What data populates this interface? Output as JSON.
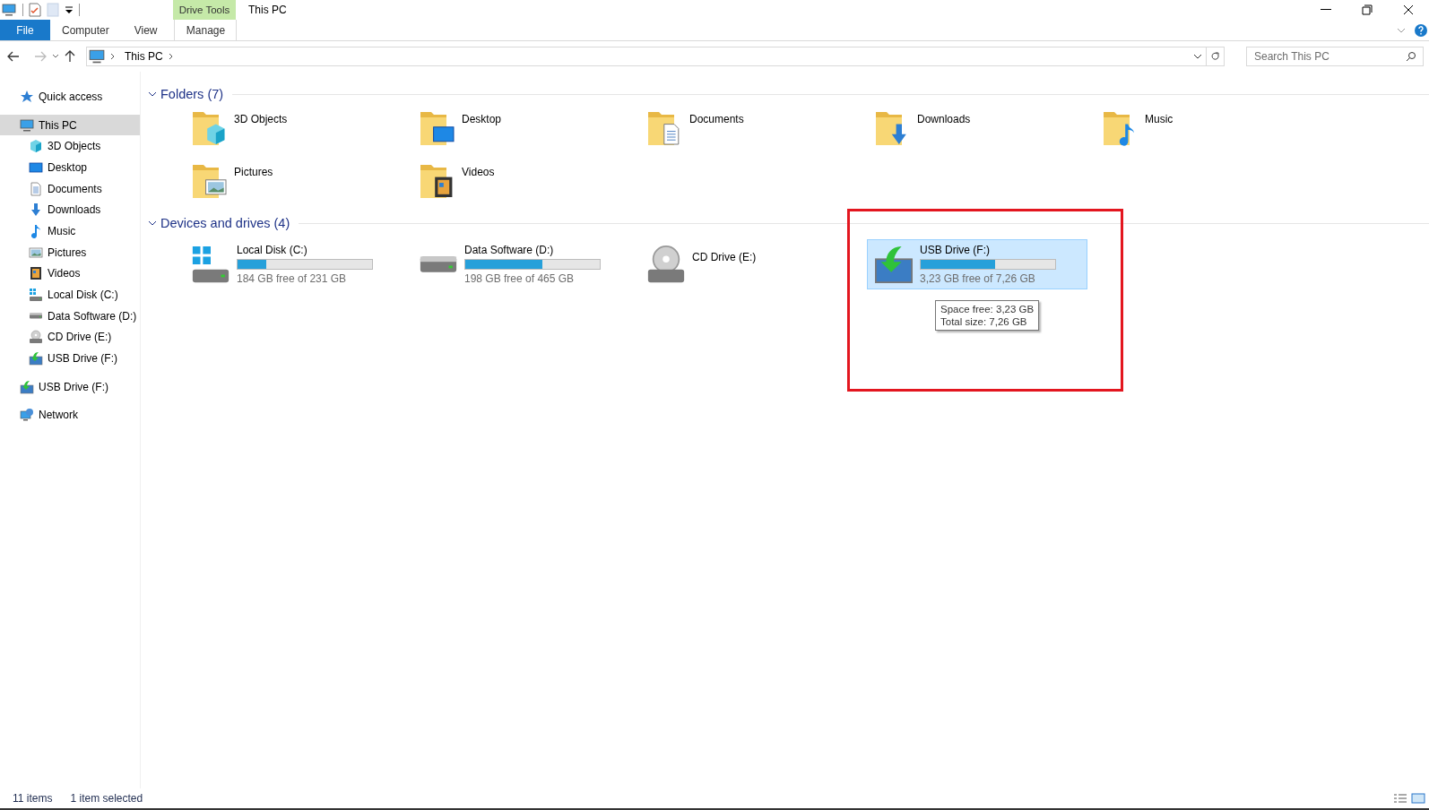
{
  "title_bar": {
    "context_tab": "Drive Tools",
    "title": "This PC"
  },
  "ribbon": {
    "tabs": [
      {
        "label": "File",
        "kind": "file"
      },
      {
        "label": "Computer",
        "kind": "normal"
      },
      {
        "label": "View",
        "kind": "normal"
      },
      {
        "label": "Manage",
        "kind": "context"
      }
    ]
  },
  "address": {
    "path": "This PC",
    "search_placeholder": "Search This PC"
  },
  "sidebar": {
    "items": [
      {
        "label": "Quick access",
        "kind": "star",
        "selected": false
      },
      {
        "label": "This PC",
        "kind": "pc",
        "selected": true,
        "children": [
          {
            "label": "3D Objects",
            "kind": "cube",
            "selected": false
          },
          {
            "label": "Desktop",
            "kind": "desktop",
            "selected": false
          },
          {
            "label": "Documents",
            "kind": "document",
            "selected": false
          },
          {
            "label": "Downloads",
            "kind": "download",
            "selected": false
          },
          {
            "label": "Music",
            "kind": "music",
            "selected": false
          },
          {
            "label": "Pictures",
            "kind": "picture",
            "selected": false
          },
          {
            "label": "Videos",
            "kind": "video",
            "selected": false
          },
          {
            "label": "Local Disk (C:)",
            "kind": "windows",
            "selected": false
          },
          {
            "label": "Data Software (D:)",
            "kind": "hdd",
            "selected": false
          },
          {
            "label": "CD Drive (E:)",
            "kind": "cd",
            "selected": false
          },
          {
            "label": "USB Drive (F:)",
            "kind": "usb",
            "selected": false
          }
        ]
      },
      {
        "label": "USB Drive (F:)",
        "kind": "usb",
        "selected": false
      },
      {
        "label": "Network",
        "kind": "network",
        "selected": false
      }
    ]
  },
  "folders": {
    "title": "Folders (7)",
    "items": [
      {
        "label": "3D Objects",
        "kind": "cube"
      },
      {
        "label": "Desktop",
        "kind": "desktop"
      },
      {
        "label": "Documents",
        "kind": "document"
      },
      {
        "label": "Downloads",
        "kind": "download"
      },
      {
        "label": "Music",
        "kind": "music"
      },
      {
        "label": "Pictures",
        "kind": "picture"
      },
      {
        "label": "Videos",
        "kind": "video"
      }
    ]
  },
  "drives": {
    "title": "Devices and drives (4)",
    "items": [
      {
        "name": "Local Disk (C:)",
        "kind": "windows",
        "level": 0.21,
        "free": "184 GB free of 231 GB",
        "selected": false
      },
      {
        "name": "Data Software (D:)",
        "kind": "hdd",
        "level": 0.57,
        "free": "198 GB free of 465 GB",
        "selected": false
      },
      {
        "name": "CD Drive (E:)",
        "kind": "cd",
        "selected": false
      },
      {
        "name": "USB Drive (F:)",
        "kind": "usb",
        "level": 0.55,
        "free": "3,23 GB free of 7,26 GB",
        "selected": true,
        "tooltip": [
          "Space free: 3,23 GB",
          "Total size: 7,26 GB"
        ]
      }
    ]
  },
  "status_bar": {
    "items_count": "11 items",
    "selection": "1 item selected"
  }
}
